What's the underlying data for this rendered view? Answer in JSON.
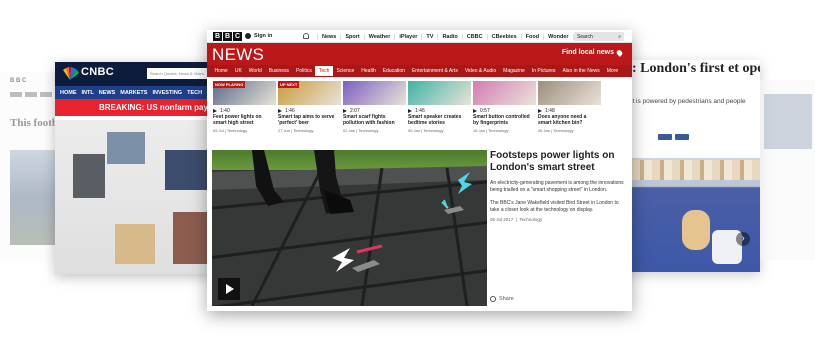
{
  "far_left": {
    "logo": "B B C",
    "title": "This football stadium is powered by foot energy"
  },
  "cnbc": {
    "brand": "CNBC",
    "search_placeholder": "Search Quotes, News & Video",
    "nav": [
      "HOME",
      "INTL",
      "NEWS",
      "MARKETS",
      "INVESTING",
      "TECH"
    ],
    "breaking": "BREAKING: US nonfarm payro"
  },
  "right_page": {
    "headline": "ag: London's first et opens",
    "standfirst": "street is powered by pedestrians and people"
  },
  "bbc": {
    "logo_letters": [
      "B",
      "B",
      "C"
    ],
    "signin": "Sign in",
    "top_nav": [
      "News",
      "Sport",
      "Weather",
      "iPlayer",
      "TV",
      "Radio",
      "CBBC",
      "CBeebies",
      "Food",
      "Wonder",
      "More"
    ],
    "top_more_arrow": "▾",
    "search_label": "Search",
    "search_icon_glyph": "⌕",
    "news_logo": "NEWS",
    "find_local": "Find local news",
    "sub_nav": [
      "Home",
      "UK",
      "World",
      "Business",
      "Politics",
      "Tech",
      "Science",
      "Health",
      "Education",
      "Entertainment & Arts",
      "Video & Audio",
      "Magazine",
      "In Pictures",
      "Also in the News",
      "More"
    ],
    "active_sub_nav": "Tech",
    "cards": [
      {
        "tag": "NOW PLAYING",
        "duration": "1:40",
        "title": "Feet power lights on smart high street",
        "date": "05 Jul",
        "section": "Technology",
        "color": "#5b6b8a"
      },
      {
        "tag": "UP NEXT",
        "duration": "1:46",
        "title": "Smart tap aims to serve 'perfect' beer",
        "date": "27 Jun",
        "section": "Technology",
        "color": "#c99a3c"
      },
      {
        "tag": "",
        "duration": "2:07",
        "title": "Smart scarf fights pollution with fashion",
        "date": "02 Jan",
        "section": "Technology",
        "color": "#7a5fc2"
      },
      {
        "tag": "",
        "duration": "1:46",
        "title": "Smart speaker creates bedtime stories",
        "date": "09 Jan",
        "section": "Technology",
        "color": "#3fb3a6"
      },
      {
        "tag": "",
        "duration": "0:57",
        "title": "Smart button controlled by fingerprints",
        "date": "16 Jan",
        "section": "Technology",
        "color": "#d67ab5"
      },
      {
        "tag": "",
        "duration": "1:48",
        "title": "Does anyone need a smart kitchen bin?",
        "date": "06 Jan",
        "section": "Technology",
        "color": "#9c8e7c"
      }
    ],
    "story": {
      "headline": "Footsteps power lights on London's smart street",
      "para1": "An electricity-generating pavement is among the innovations being trialled on a \"smart shopping street\" in London.",
      "para2": "The BBC's Jane Wakefield visited Bird Street in London to take a closer look at the technology on display.",
      "date": "05 Jul 2017",
      "section": "Technology"
    },
    "share": "Share"
  }
}
